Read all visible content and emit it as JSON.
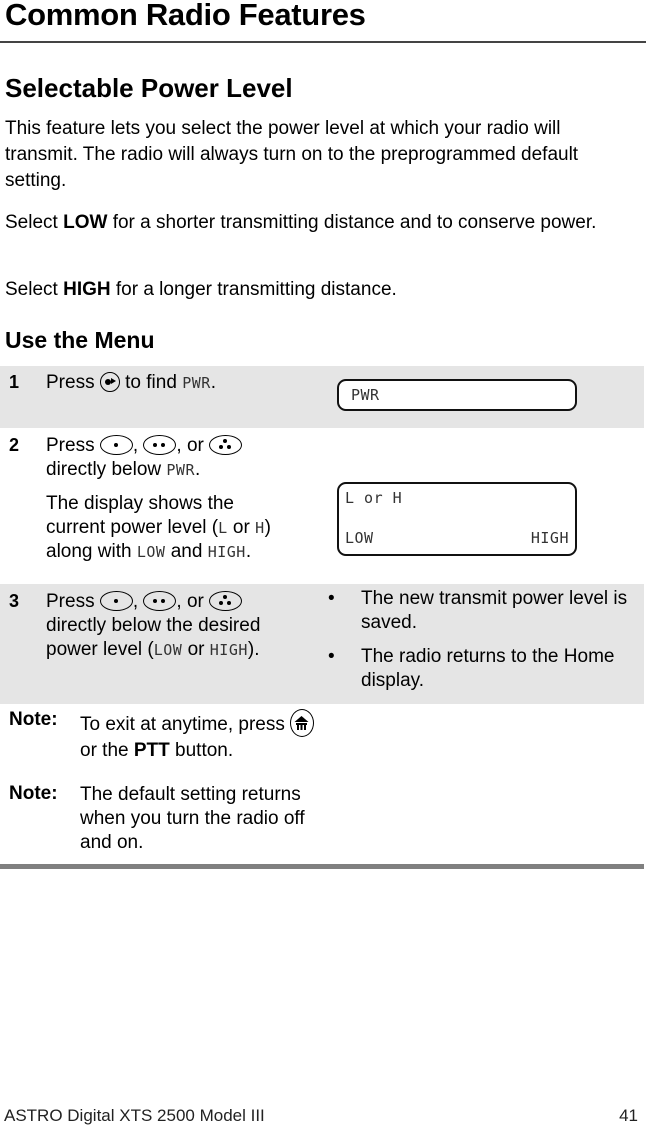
{
  "chapter": {
    "title": "Common Radio Features"
  },
  "section": {
    "title": "Selectable Power Level",
    "intro": "This feature lets you select the power level at which your radio will transmit. The radio will always turn on to the preprogrammed default setting.",
    "low_para": {
      "prefix": "Select ",
      "bold": "LOW",
      "suffix": " for a shorter transmitting distance and to conserve power."
    },
    "high_para": {
      "prefix": "Select ",
      "bold": "HIGH",
      "suffix": " for a longer transmitting distance."
    }
  },
  "menu": {
    "title": "Use the Menu",
    "steps": [
      {
        "num": "1",
        "text_before": "Press ",
        "icon": "nav-right-button-icon",
        "text_after": " to find ",
        "lcd_word": "PWR",
        "end": ".",
        "display": {
          "line1": "PWR"
        }
      },
      {
        "num": "2",
        "press": "Press ",
        "sep1": ",",
        "sep2": ", or ",
        "line2_prefix": "directly below ",
        "line2_lcd": "PWR",
        "line2_end": ".",
        "para2_a": "The display shows the current power level (",
        "para2_l": "L",
        "para2_or": " or ",
        "para2_h": "H",
        "para2_b": ") along with ",
        "para2_low": "LOW",
        "para2_and": " and ",
        "para2_high": "HIGH",
        "para2_end": ".",
        "display": {
          "line1": "L or H",
          "left": "LOW",
          "right": "HIGH"
        }
      },
      {
        "num": "3",
        "press": "Press ",
        "sep1": ",",
        "sep2": ", or ",
        "line2": "directly below the desired power level (",
        "lcd_low": "LOW",
        "or": " or ",
        "lcd_high": "HIGH",
        "end": ").",
        "bullets": [
          "The new transmit power level is saved.",
          "The radio returns to the Home display."
        ]
      }
    ]
  },
  "notes": [
    {
      "label": "Note:",
      "text_a": "To exit at anytime, press ",
      "icon": "home-button-icon",
      "text_b": " or the ",
      "bold": "PTT",
      "text_c": " button."
    },
    {
      "label": "Note:",
      "text": "The default setting returns when you turn the radio off and on."
    }
  ],
  "footer": {
    "left": "ASTRO Digital XTS 2500 Model III",
    "page": "41"
  }
}
